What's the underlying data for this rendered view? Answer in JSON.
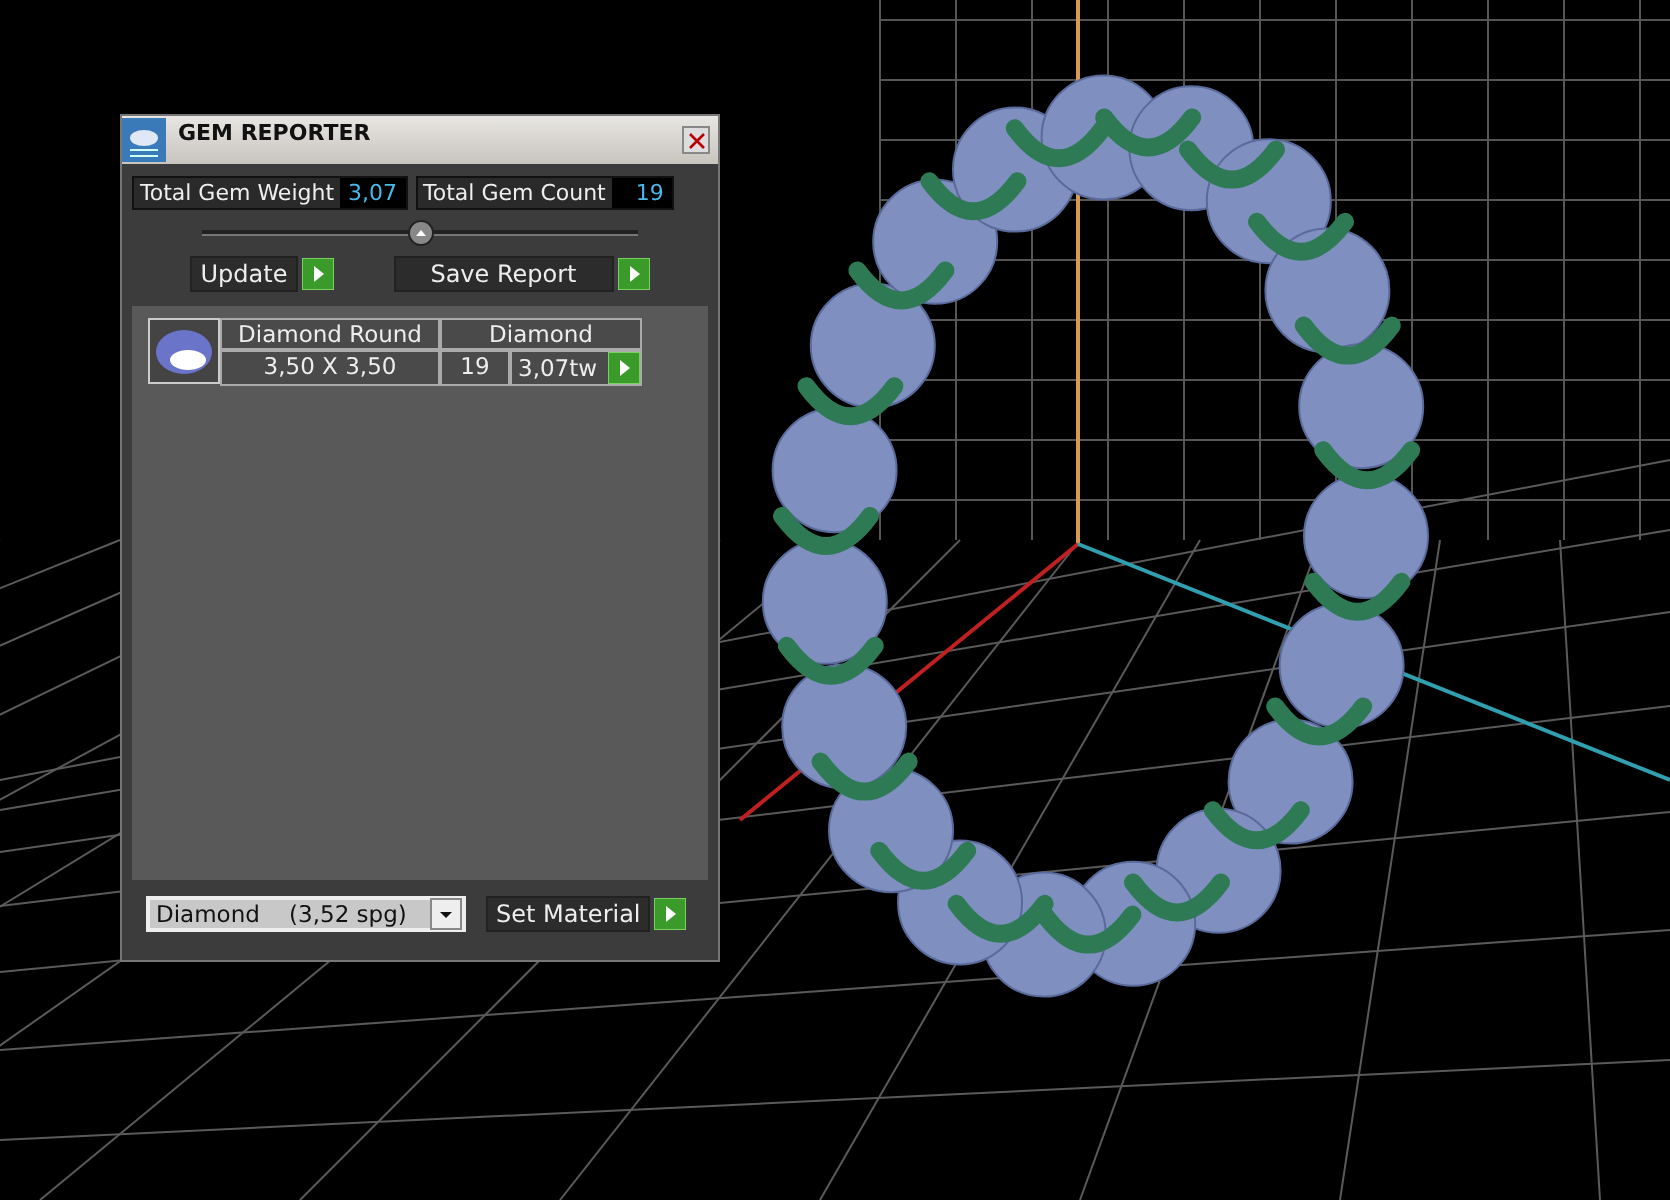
{
  "window": {
    "title": "GEM REPORTER"
  },
  "totals": [
    {
      "label": "Total Gem Weight",
      "value": "3,07"
    },
    {
      "label": "Total Gem Count",
      "value": "19"
    }
  ],
  "buttons": [
    {
      "label": "Update"
    },
    {
      "label": "Save Report"
    }
  ],
  "gems": [
    {
      "name": "Diamond Round",
      "material": "Diamond",
      "size": "3,50 X 3,50",
      "count": "19",
      "weight": "3,07tw"
    }
  ],
  "material_select": {
    "value": "Diamond    (3,52 spg)"
  },
  "set_material_button": {
    "label": "Set Material"
  }
}
